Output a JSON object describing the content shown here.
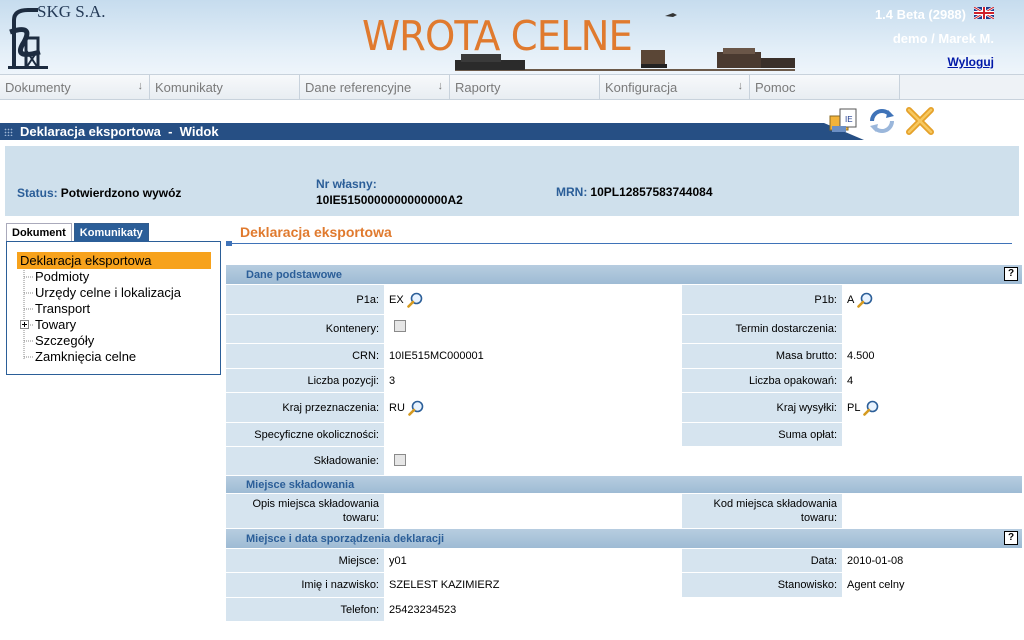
{
  "header": {
    "company": "SKG S.A.",
    "app_title": "WROTA CELNE",
    "version": "1.4 Beta (2988)",
    "user": "demo / Marek M.",
    "logout": "Wyloguj"
  },
  "menu": [
    {
      "label": "Dokumenty",
      "has_arrow": true
    },
    {
      "label": "Komunikaty",
      "has_arrow": false
    },
    {
      "label": "Dane referencyjne",
      "has_arrow": true
    },
    {
      "label": "Raporty",
      "has_arrow": false
    },
    {
      "label": "Konfiguracja",
      "has_arrow": true
    },
    {
      "label": "Pomoc",
      "has_arrow": false
    }
  ],
  "page": {
    "title": "Deklaracja eksportowa  -  Widok"
  },
  "status": {
    "status_label": "Status:",
    "status_value": "Potwierdzono wywóz",
    "nr_label": "Nr własny:",
    "nr_value": "10IE5150000000000000A2",
    "mrn_label": "MRN:",
    "mrn_value": "10PL12857583744084"
  },
  "tabs": [
    "Dokument",
    "Komunikaty"
  ],
  "tree": {
    "selected": "Deklaracja eksportowa",
    "items": [
      "Deklaracja eksportowa",
      "Podmioty",
      "Urzędy celne i lokalizacja",
      "Transport",
      "Towary",
      "Szczegóły",
      "Zamknięcia celne"
    ],
    "expandable": "Towary"
  },
  "section_title": "Deklaracja eksportowa",
  "groups": {
    "dane_podstawowe": "Dane podstawowe",
    "miejsce_skladowania": "Miejsce składowania",
    "miejsce_data": "Miejsce i data sporządzenia deklaracji"
  },
  "help_glyph": "?",
  "fields": {
    "p1a": {
      "label": "P1a:",
      "value": "EX"
    },
    "p1b": {
      "label": "P1b:",
      "value": "A"
    },
    "kontenery": {
      "label": "Kontenery:"
    },
    "termin": {
      "label": "Termin dostarczenia:",
      "value": ""
    },
    "crn": {
      "label": "CRN:",
      "value": "10IE515MC000001"
    },
    "masa": {
      "label": "Masa brutto:",
      "value": "4.500"
    },
    "liczba_pozycji": {
      "label": "Liczba pozycji:",
      "value": "3"
    },
    "liczba_opakowan": {
      "label": "Liczba opakowań:",
      "value": "4"
    },
    "kraj_przeznaczenia": {
      "label": "Kraj przeznaczenia:",
      "value": "RU"
    },
    "kraj_wysylki": {
      "label": "Kraj wysyłki:",
      "value": "PL"
    },
    "specyficzne": {
      "label": "Specyficzne okoliczności:",
      "value": ""
    },
    "suma_oplat": {
      "label": "Suma opłat:",
      "value": ""
    },
    "skladowanie": {
      "label": "Składowanie:"
    },
    "opis_miejsca": {
      "label_1": "Opis miejsca składowania",
      "label_2": "towaru:",
      "value": ""
    },
    "kod_miejsca": {
      "label_1": "Kod miejsca składowania",
      "label_2": "towaru:",
      "value": ""
    },
    "miejsce": {
      "label": "Miejsce:",
      "value": "y01"
    },
    "data": {
      "label": "Data:",
      "value": "2010-01-08"
    },
    "imie": {
      "label": "Imię i nazwisko:",
      "value": "SZELEST KAZIMIERZ"
    },
    "stanowisko": {
      "label": "Stanowisko:",
      "value": "Agent celny"
    },
    "telefon": {
      "label": "Telefon:",
      "value": "25423234523"
    }
  },
  "colors": {
    "accent_orange": "#e07a2e",
    "header_blue": "#264f84",
    "label_blue": "#2b5e98",
    "panel": "#cfe0ec"
  }
}
